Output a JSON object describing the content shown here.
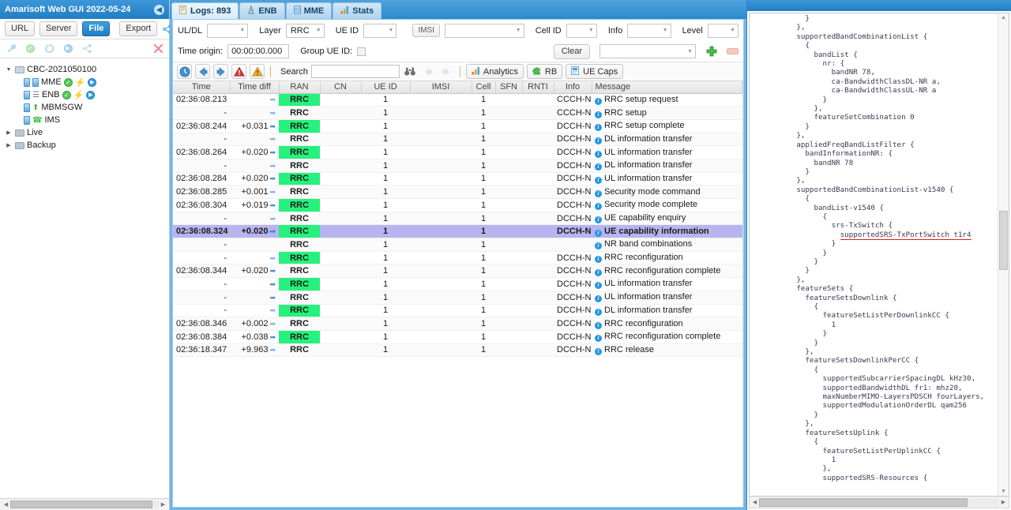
{
  "left": {
    "title": "Amarisoft Web GUI 2022-05-24",
    "collapse_icon": "chevron-left-icon",
    "toolbar": {
      "url_label": "URL",
      "server_label": "Server",
      "file_label": "File",
      "export_label": "Export",
      "share_icon": "share-icon"
    },
    "toolbar2": {
      "wrench_icon": "wrench-icon",
      "check_icon": "check-circle-icon",
      "refresh_icon": "refresh-icon",
      "play_icon": "play-circle-icon",
      "link_icon": "link-icon",
      "close_icon": "close-icon"
    },
    "tree": [
      {
        "label": "CBC-2021050100",
        "level": 0,
        "twisty": "▼",
        "icon": "folder-open-icon"
      },
      {
        "label": "MME",
        "level": 1,
        "icon": "database-icon",
        "badges": [
          "check",
          "bolt",
          "play"
        ]
      },
      {
        "label": "ENB",
        "level": 1,
        "icon": "tower-icon",
        "badges": [
          "check",
          "bolt",
          "play"
        ]
      },
      {
        "label": "MBMSGW",
        "level": 1,
        "icon": "upload-icon",
        "badges": []
      },
      {
        "label": "IMS",
        "level": 1,
        "icon": "phone-icon",
        "badges": []
      },
      {
        "label": "Live",
        "level": 0,
        "twisty": "▶",
        "icon": "folder-icon"
      },
      {
        "label": "Backup",
        "level": 0,
        "twisty": "▶",
        "icon": "folder-icon"
      }
    ]
  },
  "tabs": [
    {
      "label": "Logs: 893",
      "icon": "document-icon",
      "selected": true
    },
    {
      "label": "ENB",
      "icon": "tower-icon",
      "selected": false
    },
    {
      "label": "MME",
      "icon": "database-icon",
      "selected": false
    },
    {
      "label": "Stats",
      "icon": "bar-chart-icon",
      "selected": false
    }
  ],
  "filters": {
    "uldl_label": "UL/DL",
    "uldl_value": "",
    "layer_label": "Layer",
    "layer_value": "RRC",
    "ueid_label": "UE ID",
    "ueid_value": "",
    "imsi_label": "IMSI",
    "imsi_value": "",
    "cellid_label": "Cell ID",
    "cellid_value": "",
    "info_label": "Info",
    "info_value": "",
    "level_label": "Level",
    "level_value": "",
    "time_origin_label": "Time origin:",
    "time_origin_value": "00:00:00.000",
    "group_ueid_label": "Group UE ID:",
    "group_ueid_checked": false,
    "clear_label": "Clear",
    "preset_value": "",
    "add_icon": "plus-icon",
    "remove_icon": "minus-icon"
  },
  "toolbar": {
    "clock_icon": "clock-icon",
    "prev_icon": "arrow-left-icon",
    "next_icon": "arrow-right-icon",
    "error_icon": "error-triangle-icon",
    "warning_icon": "warning-triangle-icon",
    "search_label": "Search",
    "search_value": "",
    "binoculars_icon": "binoculars-icon",
    "search_prev_icon": "arrow-left-icon",
    "search_next_icon": "arrow-right-icon",
    "analytics_label": "Analytics",
    "analytics_icon": "bar-chart-icon",
    "rb_label": "RB",
    "rb_icon": "puzzle-icon",
    "uecaps_label": "UE Caps",
    "uecaps_icon": "page-icon"
  },
  "table": {
    "columns": [
      "Time",
      "Time diff",
      "RAN",
      "CN",
      "UE ID",
      "IMSI",
      "Cell",
      "SFN",
      "RNTI",
      "Info",
      "Message"
    ],
    "rows": [
      {
        "time": "02:36:08.213",
        "diff": "",
        "dir": "dl",
        "ran": "RRC",
        "cn": "",
        "ueid": "1",
        "imsi": "",
        "cell": "1",
        "sfn": "",
        "rnti": "",
        "info": "CCCH-NR",
        "message": "RRC setup request",
        "selected": false
      },
      {
        "time": "-",
        "diff": "",
        "dir": "dl",
        "ran": "RRC",
        "cn": "",
        "ueid": "1",
        "imsi": "",
        "cell": "1",
        "sfn": "",
        "rnti": "",
        "info": "CCCH-NR",
        "message": "RRC setup",
        "selected": false
      },
      {
        "time": "02:36:08.244",
        "diff": "+0.031",
        "dir": "ul",
        "ran": "RRC",
        "cn": "",
        "ueid": "1",
        "imsi": "",
        "cell": "1",
        "sfn": "",
        "rnti": "",
        "info": "DCCH-NR",
        "message": "RRC setup complete",
        "selected": false
      },
      {
        "time": "-",
        "diff": "",
        "dir": "dl",
        "ran": "RRC",
        "cn": "",
        "ueid": "1",
        "imsi": "",
        "cell": "1",
        "sfn": "",
        "rnti": "",
        "info": "DCCH-NR",
        "message": "DL information transfer",
        "selected": false
      },
      {
        "time": "02:36:08.264",
        "diff": "+0.020",
        "dir": "ul",
        "ran": "RRC",
        "cn": "",
        "ueid": "1",
        "imsi": "",
        "cell": "1",
        "sfn": "",
        "rnti": "",
        "info": "DCCH-NR",
        "message": "UL information transfer",
        "selected": false
      },
      {
        "time": "-",
        "diff": "",
        "dir": "dl",
        "ran": "RRC",
        "cn": "",
        "ueid": "1",
        "imsi": "",
        "cell": "1",
        "sfn": "",
        "rnti": "",
        "info": "DCCH-NR",
        "message": "DL information transfer",
        "selected": false
      },
      {
        "time": "02:36:08.284",
        "diff": "+0.020",
        "dir": "ul",
        "ran": "RRC",
        "cn": "",
        "ueid": "1",
        "imsi": "",
        "cell": "1",
        "sfn": "",
        "rnti": "",
        "info": "DCCH-NR",
        "message": "UL information transfer",
        "selected": false
      },
      {
        "time": "02:36:08.285",
        "diff": "+0.001",
        "dir": "dl",
        "ran": "RRC",
        "cn": "",
        "ueid": "1",
        "imsi": "",
        "cell": "1",
        "sfn": "",
        "rnti": "",
        "info": "DCCH-NR",
        "message": "Security mode command",
        "selected": false
      },
      {
        "time": "02:36:08.304",
        "diff": "+0.019",
        "dir": "ul",
        "ran": "RRC",
        "cn": "",
        "ueid": "1",
        "imsi": "",
        "cell": "1",
        "sfn": "",
        "rnti": "",
        "info": "DCCH-NR",
        "message": "Security mode complete",
        "selected": false
      },
      {
        "time": "-",
        "diff": "",
        "dir": "dl",
        "ran": "RRC",
        "cn": "",
        "ueid": "1",
        "imsi": "",
        "cell": "1",
        "sfn": "",
        "rnti": "",
        "info": "DCCH-NR",
        "message": "UE capability enquiry",
        "selected": false
      },
      {
        "time": "02:36:08.324",
        "diff": "+0.020",
        "dir": "ul",
        "ran": "RRC",
        "cn": "",
        "ueid": "1",
        "imsi": "",
        "cell": "1",
        "sfn": "",
        "rnti": "",
        "info": "DCCH-NR",
        "message": "UE capability information",
        "selected": true
      },
      {
        "time": "-",
        "diff": "",
        "dir": "",
        "ran": "RRC",
        "cn": "",
        "ueid": "1",
        "imsi": "",
        "cell": "1",
        "sfn": "",
        "rnti": "",
        "info": "",
        "message": "NR band combinations",
        "selected": false
      },
      {
        "time": "-",
        "diff": "",
        "dir": "dl",
        "ran": "RRC",
        "cn": "",
        "ueid": "1",
        "imsi": "",
        "cell": "1",
        "sfn": "",
        "rnti": "",
        "info": "DCCH-NR",
        "message": "RRC reconfiguration",
        "selected": false
      },
      {
        "time": "02:36:08.344",
        "diff": "+0.020",
        "dir": "ul",
        "ran": "RRC",
        "cn": "",
        "ueid": "1",
        "imsi": "",
        "cell": "1",
        "sfn": "",
        "rnti": "",
        "info": "DCCH-NR",
        "message": "RRC reconfiguration complete",
        "selected": false
      },
      {
        "time": "-",
        "diff": "",
        "dir": "ul",
        "ran": "RRC",
        "cn": "",
        "ueid": "1",
        "imsi": "",
        "cell": "1",
        "sfn": "",
        "rnti": "",
        "info": "DCCH-NR",
        "message": "UL information transfer",
        "selected": false
      },
      {
        "time": "-",
        "diff": "",
        "dir": "ul",
        "ran": "RRC",
        "cn": "",
        "ueid": "1",
        "imsi": "",
        "cell": "1",
        "sfn": "",
        "rnti": "",
        "info": "DCCH-NR",
        "message": "UL information transfer",
        "selected": false
      },
      {
        "time": "-",
        "diff": "",
        "dir": "dl",
        "ran": "RRC",
        "cn": "",
        "ueid": "1",
        "imsi": "",
        "cell": "1",
        "sfn": "",
        "rnti": "",
        "info": "DCCH-NR",
        "message": "DL information transfer",
        "selected": false
      },
      {
        "time": "02:36:08.346",
        "diff": "+0.002",
        "dir": "dl",
        "ran": "RRC",
        "cn": "",
        "ueid": "1",
        "imsi": "",
        "cell": "1",
        "sfn": "",
        "rnti": "",
        "info": "DCCH-NR",
        "message": "RRC reconfiguration",
        "selected": false
      },
      {
        "time": "02:36:08.384",
        "diff": "+0.038",
        "dir": "ul",
        "ran": "RRC",
        "cn": "",
        "ueid": "1",
        "imsi": "",
        "cell": "1",
        "sfn": "",
        "rnti": "",
        "info": "DCCH-NR",
        "message": "RRC reconfiguration complete",
        "selected": false
      },
      {
        "time": "02:36:18.347",
        "diff": "+9.963",
        "dir": "dl",
        "ran": "RRC",
        "cn": "",
        "ueid": "1",
        "imsi": "",
        "cell": "1",
        "sfn": "",
        "rnti": "",
        "info": "DCCH-NR",
        "message": "RRC release",
        "selected": false
      }
    ]
  },
  "detail": {
    "code_before": "            }\n          },\n          supportedBandCombinationList {\n            {\n              bandList {\n                nr: {\n                  bandNR 78,\n                  ca-BandwidthClassDL-NR a,\n                  ca-BandwidthClassUL-NR a\n                }\n              },\n              featureSetCombination 0\n            }\n          },\n          appliedFreqBandListFilter {\n            bandInformationNR: {\n              bandNR 78\n            }\n          },\n          supportedBandCombinationList-v1540 {\n            {\n              bandList-v1540 {\n                {\n                  srs-TxSwitch {\n                    ",
    "code_highlight": "supportedSRS-TxPortSwitch t1r4",
    "code_after": "\n                  }\n                }\n              }\n            }\n          },\n          featureSets {\n            featureSetsDownlink {\n              {\n                featureSetListPerDownlinkCC {\n                  1\n                }\n              }\n            },\n            featureSetsDownlinkPerCC {\n              {\n                supportedSubcarrierSpacingDL kHz30,\n                supportedBandwidthDL fr1: mhz20,\n                maxNumberMIMO-LayersPDSCH fourLayers,\n                supportedModulationOrderDL qam256\n              }\n            },\n            featureSetsUplink {\n              {\n                featureSetListPerUplinkCC {\n                  1\n                },\n                supportedSRS-Resources {",
    "highlight_color": "#e01b1b"
  },
  "colors": {
    "title_bar": "#2b8acb",
    "ran_cell": "#25f17c",
    "selected_row": "#b8b4ef",
    "accent_blue": "#1f7fc4"
  }
}
